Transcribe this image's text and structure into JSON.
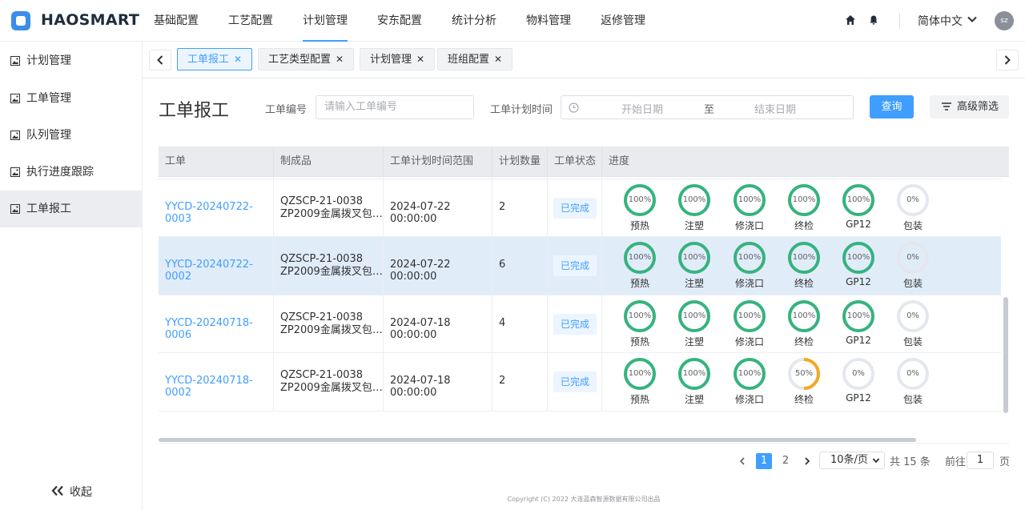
{
  "brand": "HAOSMART",
  "top_menu": [
    {
      "label": "基础配置"
    },
    {
      "label": "工艺配置"
    },
    {
      "label": "计划管理"
    },
    {
      "label": "安东配置"
    },
    {
      "label": "统计分析"
    },
    {
      "label": "物料管理"
    },
    {
      "label": "返修管理"
    }
  ],
  "active_menu": "计划管理",
  "language": "简体中文",
  "avatar_text": "sz",
  "sidebar": {
    "items": [
      {
        "label": "计划管理"
      },
      {
        "label": "工单管理"
      },
      {
        "label": "队列管理"
      },
      {
        "label": "执行进度跟踪"
      },
      {
        "label": "工单报工"
      }
    ],
    "active": "工单报工",
    "collapse_label": "收起"
  },
  "tabs": [
    {
      "label": "工单报工",
      "active": true
    },
    {
      "label": "工艺类型配置",
      "active": false
    },
    {
      "label": "计划管理",
      "active": false
    },
    {
      "label": "班组配置",
      "active": false
    }
  ],
  "page": {
    "title": "工单报工",
    "filters": {
      "order_label": "工单编号",
      "order_placeholder": "请输入工单编号",
      "time_label": "工单计划时间",
      "start_placeholder": "开始日期",
      "range_sep": "至",
      "end_placeholder": "结束日期",
      "query_button": "查询",
      "advanced_button": "高级筛选"
    }
  },
  "table": {
    "columns": [
      "工单",
      "制成品",
      "工单计划时间范围",
      "计划数量",
      "工单状态",
      "进度"
    ],
    "steps": [
      "预热",
      "注塑",
      "修浇口",
      "终检",
      "GP12",
      "包装"
    ],
    "rows": [
      {
        "order": "",
        "product_code": "",
        "product_name": "ZP2009金属拨叉包…",
        "time": "",
        "qty": "",
        "status": "",
        "progress": [
          100,
          100,
          100,
          100,
          100,
          0
        ],
        "partial": true
      },
      {
        "order": "YYCD-20240722-0003",
        "product_code": "QZSCP-21-0038",
        "product_name": "ZP2009金属拨叉包…",
        "time": "2024-07-22 00:00:00",
        "qty": "2",
        "status": "已完成",
        "progress": [
          100,
          100,
          100,
          100,
          100,
          0
        ]
      },
      {
        "order": "YYCD-20240722-0002",
        "product_code": "QZSCP-21-0038",
        "product_name": "ZP2009金属拨叉包…",
        "time": "2024-07-22 00:00:00",
        "qty": "6",
        "status": "已完成",
        "progress": [
          100,
          100,
          100,
          100,
          100,
          0
        ],
        "selected": true
      },
      {
        "order": "YYCD-20240718-0006",
        "product_code": "QZSCP-21-0038",
        "product_name": "ZP2009金属拨叉包…",
        "time": "2024-07-18 00:00:00",
        "qty": "4",
        "status": "已完成",
        "progress": [
          100,
          100,
          100,
          100,
          100,
          0
        ]
      },
      {
        "order": "YYCD-20240718-0002",
        "product_code": "QZSCP-21-0038",
        "product_name": "ZP2009金属拨叉包…",
        "time": "2024-07-18 00:00:00",
        "qty": "2",
        "status": "已完成",
        "progress": [
          100,
          100,
          100,
          50,
          0,
          0
        ]
      }
    ]
  },
  "pagination": {
    "pages": [
      "1",
      "2"
    ],
    "current": "1",
    "page_size": "10条/页",
    "total": "共 15 条",
    "goto_label": "前往",
    "goto_value": "1",
    "goto_suffix": "页"
  },
  "copyright": "Copyright (C) 2022 大连蓝森智源数据有限公司出品",
  "colors": {
    "accent": "#409eff",
    "complete": "#36b37e",
    "partial": "#f5a623",
    "empty": "#e4e7ed"
  }
}
